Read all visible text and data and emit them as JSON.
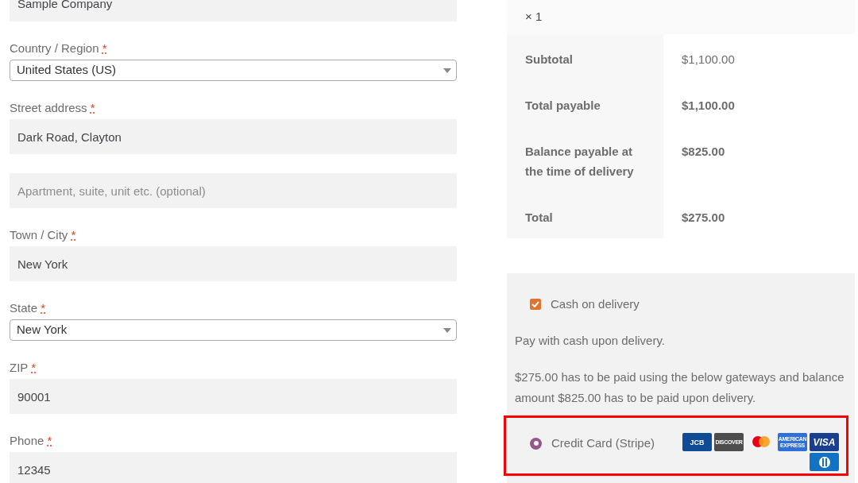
{
  "billing_fields": [
    {
      "kind": "input",
      "value": "Sample Company"
    },
    {
      "kind": "select",
      "label": "Country / Region",
      "required": true,
      "value": "United States (US)"
    },
    {
      "kind": "input",
      "label": "Street address",
      "required": true,
      "value": "Dark Road, Clayton"
    },
    {
      "kind": "input",
      "placeholder": "Apartment, suite, unit etc. (optional)"
    },
    {
      "kind": "input",
      "label": "Town / City",
      "required": true,
      "value": "New York"
    },
    {
      "kind": "select",
      "label": "State",
      "required": true,
      "value": "New York"
    },
    {
      "kind": "input",
      "label": "ZIP",
      "required": true,
      "value": "90001"
    },
    {
      "kind": "input",
      "label": "Phone",
      "required": true,
      "value": "12345"
    }
  ],
  "required_mark": "*",
  "order_summary": {
    "quantity": "× 1",
    "rows": [
      {
        "label": "Subtotal",
        "value": "$1,100.00",
        "bold_value": false
      },
      {
        "label": "Total payable",
        "value": "$1,100.00",
        "bold_value": true
      },
      {
        "label": "Balance payable at the time of delivery",
        "value": "$825.00",
        "bold_value": true
      },
      {
        "label": "Total",
        "value": "$275.00",
        "bold_value": true
      }
    ]
  },
  "payment": {
    "methods": [
      {
        "kind": "checkbox",
        "label": "Cash on delivery",
        "checked": true
      },
      {
        "kind": "radio",
        "label": "Credit Card (Stripe)",
        "selected": true,
        "highlighted": true
      }
    ],
    "notes": [
      "Pay with cash upon delivery.",
      "$275.00 has to be paid using the below gateways and balance amount $825.00 has to be paid upon delivery."
    ],
    "cards": [
      {
        "kind": "jcb",
        "label": "JCB"
      },
      {
        "kind": "discover",
        "label": "DISCOVER"
      },
      {
        "kind": "mastercard"
      },
      {
        "kind": "amex",
        "label": "AMERICAN EXPRESS"
      },
      {
        "kind": "visa",
        "label": "VISA"
      },
      {
        "kind": "diners"
      }
    ]
  }
}
